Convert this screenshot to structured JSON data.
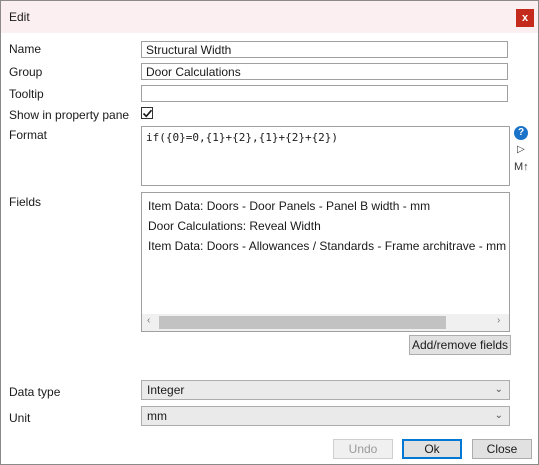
{
  "window": {
    "title": "Edit",
    "close_glyph": "x"
  },
  "form": {
    "name_label": "Name",
    "name_value": "Structural Width",
    "group_label": "Group",
    "group_value": "Door Calculations",
    "tooltip_label": "Tooltip",
    "tooltip_value": "",
    "show_label": "Show in property pane",
    "show_checked": true,
    "format_label": "Format",
    "format_value": "if({0}=0,{1}+{2},{1}+{2}+{2})",
    "fields_label": "Fields",
    "fields": [
      "Item Data: Doors - Door Panels - Panel B width - mm",
      "Door Calculations: Reveal Width",
      "Item Data: Doors - Allowances / Standards - Frame architrave - mm ("
    ],
    "add_remove_label": "Add/remove fields",
    "datatype_label": "Data type",
    "datatype_value": "Integer",
    "unit_label": "Unit",
    "unit_value": "mm"
  },
  "icons": {
    "help": "?",
    "play": "▷",
    "markdown": "M↑"
  },
  "footer": {
    "undo": "Undo",
    "ok": "Ok",
    "close": "Close"
  },
  "colors": {
    "titlebar": "#fbeff1",
    "close_button": "#c42b1c",
    "help_icon": "#1a73c8"
  }
}
